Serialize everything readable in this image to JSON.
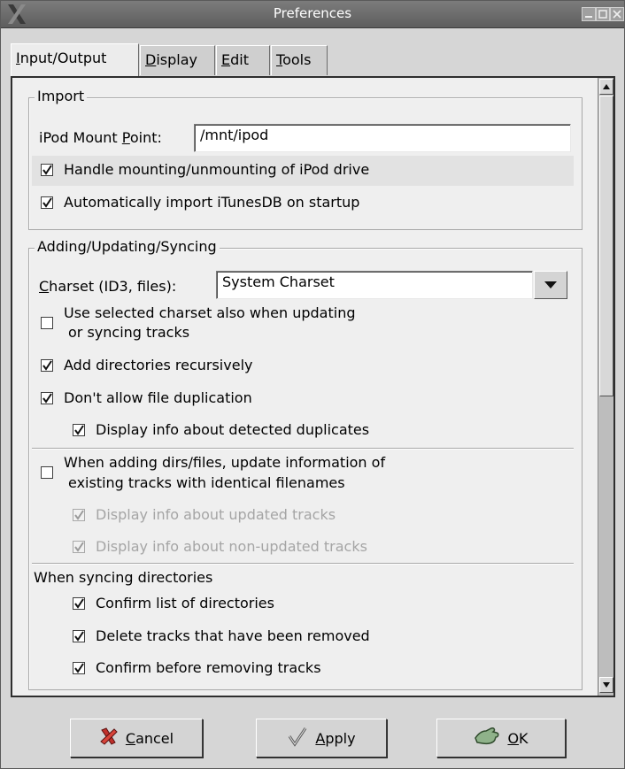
{
  "window": {
    "title": "Preferences"
  },
  "tabs": [
    {
      "label": "Input/Output",
      "mnemonic": "I",
      "rest": "nput/Output",
      "active": true
    },
    {
      "label": "Display",
      "mnemonic": "D",
      "rest": "isplay",
      "active": false
    },
    {
      "label": "Edit",
      "mnemonic": "E",
      "rest": "dit",
      "active": false
    },
    {
      "label": "Tools",
      "mnemonic": "T",
      "rest": "ools",
      "active": false
    }
  ],
  "import": {
    "title": "Import",
    "mount_label_a": "iPod Mount ",
    "mount_label_mn": "P",
    "mount_label_b": "oint:",
    "mount_value": "/mnt/ipod",
    "handle_mount_label": "Handle mounting/unmounting of iPod drive",
    "handle_mount_checked": true,
    "auto_import_label": "Automatically import iTunesDB on startup",
    "auto_import_checked": true
  },
  "adding": {
    "title": "Adding/Updating/Syncing",
    "charset_label_mn": "C",
    "charset_label_rest": "harset (ID3, files):",
    "charset_value": "System Charset",
    "use_charset_line1": "Use selected charset also when updating",
    "use_charset_line2": "or syncing tracks",
    "use_charset_checked": false,
    "add_recursive_label": "Add directories recursively",
    "add_recursive_checked": true,
    "no_dup_label": "Don't allow file duplication",
    "no_dup_checked": true,
    "show_dup_label": "Display info about detected duplicates",
    "show_dup_checked": true,
    "update_info_line1": "When adding dirs/files, update information of",
    "update_info_line2": "existing tracks with identical filenames",
    "update_info_checked": false,
    "show_updated_label": "Display info about updated tracks",
    "show_updated_checked": true,
    "show_nonupdated_label": "Display info about non-updated tracks",
    "show_nonupdated_checked": true,
    "sync_heading": "When syncing directories",
    "confirm_dirs_label": "Confirm list of directories",
    "confirm_dirs_checked": true,
    "delete_removed_label": "Delete tracks that have been removed",
    "delete_removed_checked": true,
    "confirm_remove_label": "Confirm before removing tracks",
    "confirm_remove_checked": true
  },
  "buttons": {
    "cancel_mn": "C",
    "cancel_rest": "ancel",
    "apply_mn": "A",
    "apply_rest": "pply",
    "ok_mn": "O",
    "ok_rest": "K"
  },
  "icons": {
    "check": "checkmark-icon",
    "x_logo": "x-window-logo-icon",
    "cancel": "red-x-icon",
    "apply": "check-hand-icon",
    "ok": "ok-hand-icon"
  }
}
